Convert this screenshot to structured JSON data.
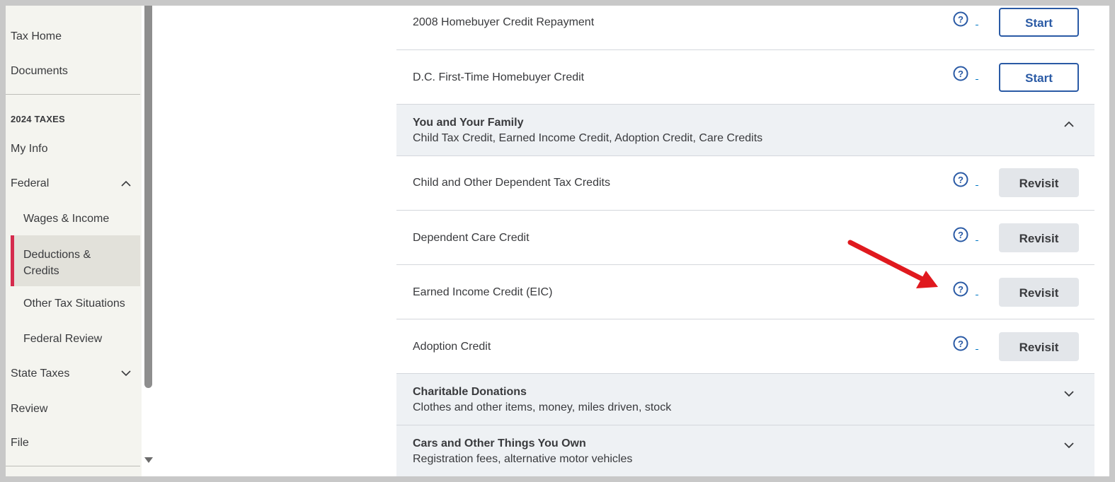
{
  "sidebar": {
    "items": [
      {
        "label": "Tax Home"
      },
      {
        "label": "Documents"
      }
    ],
    "section_title": "2024 TAXES",
    "tax_items": [
      {
        "label": "My Info"
      },
      {
        "label": "Federal"
      },
      {
        "label": "Wages & Income"
      },
      {
        "label": "Deductions & Credits"
      },
      {
        "label": "Other Tax Situations"
      },
      {
        "label": "Federal Review"
      },
      {
        "label": "State Taxes"
      },
      {
        "label": "Review"
      },
      {
        "label": "File"
      }
    ],
    "active_accent": "#d52b4d"
  },
  "main": {
    "top_rows": [
      {
        "label": "2008 Homebuyer Credit Repayment",
        "button": "Start"
      },
      {
        "label": "D.C. First-Time Homebuyer Credit",
        "button": "Start"
      }
    ],
    "family_group": {
      "title": "You and Your Family",
      "subtitle": "Child Tax Credit, Earned Income Credit, Adoption Credit, Care Credits",
      "expanded": true
    },
    "family_rows": [
      {
        "label": "Child and Other Dependent Tax Credits",
        "button": "Revisit"
      },
      {
        "label": "Dependent Care Credit",
        "button": "Revisit"
      },
      {
        "label": "Earned Income Credit (EIC)",
        "button": "Revisit"
      },
      {
        "label": "Adoption Credit",
        "button": "Revisit"
      }
    ],
    "collapsed_groups": [
      {
        "title": "Charitable Donations",
        "subtitle": "Clothes and other items, money, miles driven, stock"
      },
      {
        "title": "Cars and Other Things You Own",
        "subtitle": "Registration fees, alternative motor vehicles"
      }
    ],
    "icons": {
      "help": "help-circle-icon",
      "expand": "chevron-up-icon",
      "collapse": "chevron-down-icon"
    },
    "colors": {
      "primary_blue": "#2a5aa5",
      "annotation_red": "#e0191e",
      "group_bg": "#eef1f4"
    }
  }
}
